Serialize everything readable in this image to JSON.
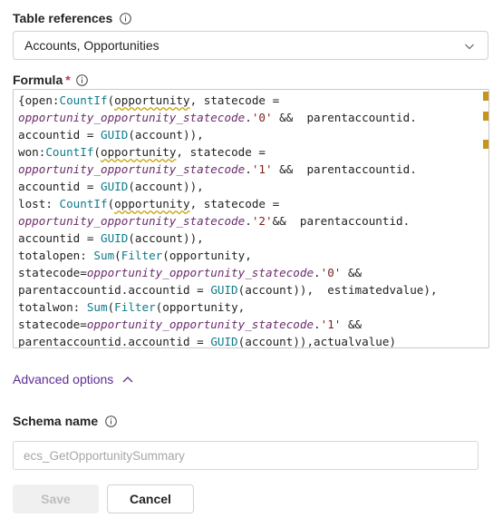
{
  "table_references": {
    "label": "Table references",
    "value": "Accounts, Opportunities"
  },
  "formula": {
    "label": "Formula",
    "required_marker": "*",
    "lines": [
      [
        {
          "t": "{open:"
        },
        {
          "t": "CountIf",
          "c": "fn"
        },
        {
          "t": "("
        },
        {
          "t": "opportunity",
          "c": "sq"
        },
        {
          "t": ", statecode ="
        }
      ],
      [
        {
          "t": "opportunity_opportunity_statecode",
          "c": "enum"
        },
        {
          "t": "."
        },
        {
          "t": "'0'",
          "c": "str"
        },
        {
          "t": " &&  parentaccountid."
        }
      ],
      [
        {
          "t": "accountid = "
        },
        {
          "t": "GUID",
          "c": "fn"
        },
        {
          "t": "(account)),"
        }
      ],
      [
        {
          "t": "won:"
        },
        {
          "t": "CountIf",
          "c": "fn"
        },
        {
          "t": "("
        },
        {
          "t": "opportunity",
          "c": "sq"
        },
        {
          "t": ", statecode ="
        }
      ],
      [
        {
          "t": "opportunity_opportunity_statecode",
          "c": "enum"
        },
        {
          "t": "."
        },
        {
          "t": "'1'",
          "c": "str"
        },
        {
          "t": " &&  parentaccountid."
        }
      ],
      [
        {
          "t": "accountid = "
        },
        {
          "t": "GUID",
          "c": "fn"
        },
        {
          "t": "(account)),"
        }
      ],
      [
        {
          "t": "lost: "
        },
        {
          "t": "CountIf",
          "c": "fn"
        },
        {
          "t": "("
        },
        {
          "t": "opportunity",
          "c": "sq"
        },
        {
          "t": ", statecode ="
        }
      ],
      [
        {
          "t": "opportunity_opportunity_statecode",
          "c": "enum"
        },
        {
          "t": "."
        },
        {
          "t": "'2'",
          "c": "str"
        },
        {
          "t": "&&  parentaccountid."
        }
      ],
      [
        {
          "t": "accountid = "
        },
        {
          "t": "GUID",
          "c": "fn"
        },
        {
          "t": "(account)),"
        }
      ],
      [
        {
          "t": "totalopen: "
        },
        {
          "t": "Sum",
          "c": "fn"
        },
        {
          "t": "("
        },
        {
          "t": "Filter",
          "c": "fn"
        },
        {
          "t": "(opportunity,"
        }
      ],
      [
        {
          "t": "statecode="
        },
        {
          "t": "opportunity_opportunity_statecode",
          "c": "enum"
        },
        {
          "t": "."
        },
        {
          "t": "'0'",
          "c": "str"
        },
        {
          "t": " &&"
        }
      ],
      [
        {
          "t": "parentaccountid.accountid = "
        },
        {
          "t": "GUID",
          "c": "fn"
        },
        {
          "t": "(account)),  estimatedvalue),"
        }
      ],
      [
        {
          "t": "totalwon: "
        },
        {
          "t": "Sum",
          "c": "fn"
        },
        {
          "t": "("
        },
        {
          "t": "Filter",
          "c": "fn"
        },
        {
          "t": "(opportunity,"
        }
      ],
      [
        {
          "t": "statecode="
        },
        {
          "t": "opportunity_opportunity_statecode",
          "c": "enum"
        },
        {
          "t": "."
        },
        {
          "t": "'1'",
          "c": "str"
        },
        {
          "t": " &&"
        }
      ],
      [
        {
          "t": "parentaccountid.accountid = "
        },
        {
          "t": "GUID",
          "c": "fn"
        },
        {
          "t": "(account)),actualvalue)"
        }
      ]
    ]
  },
  "advanced_options": {
    "label": "Advanced options"
  },
  "schema_name": {
    "label": "Schema name",
    "placeholder": "ecs_GetOpportunitySummary"
  },
  "buttons": {
    "save": "Save",
    "cancel": "Cancel"
  },
  "colors": {
    "accent_purple": "#5c2d91",
    "required_red": "#c4314b",
    "function_teal": "#0d7a8a",
    "enum_purple": "#6b2d6b",
    "string_red": "#7a1e1e",
    "squiggle_gold": "#c8a000"
  }
}
